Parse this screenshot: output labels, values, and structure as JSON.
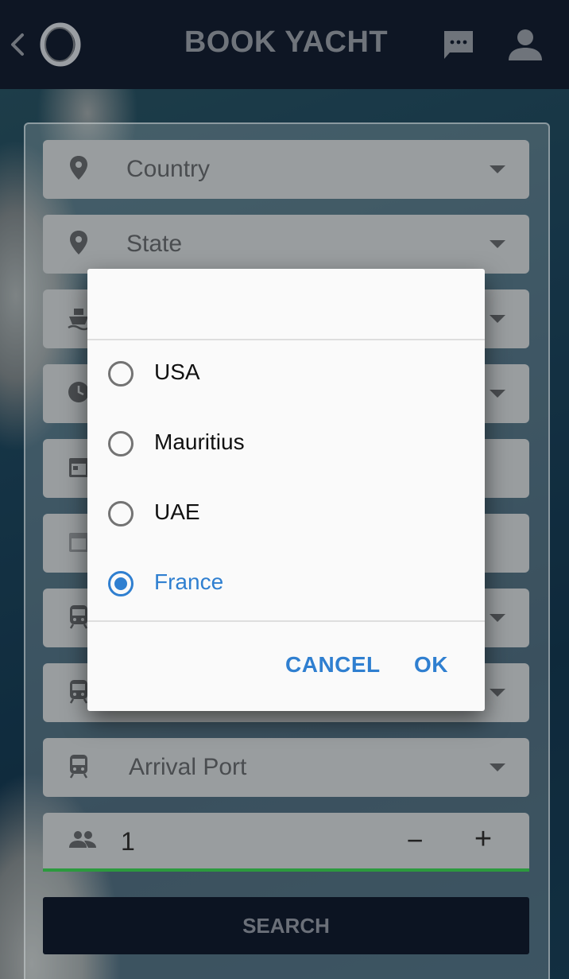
{
  "app_bar": {
    "title": "BOOK YACHT",
    "icons": {
      "back": "back-icon",
      "logo": "logo-icon",
      "chat": "chat-icon",
      "profile": "user-icon"
    }
  },
  "form": {
    "fields": [
      {
        "label": "Country",
        "icon": "location-pin-icon"
      },
      {
        "label": "State",
        "icon": "location-pin-icon"
      },
      {
        "label": "",
        "icon": "ship-icon"
      },
      {
        "label": "",
        "icon": "clock-icon"
      },
      {
        "label": "",
        "icon": "calendar-icon"
      },
      {
        "label": "",
        "icon": "calendar-icon"
      },
      {
        "label": "",
        "icon": "train-icon"
      },
      {
        "label": "",
        "icon": "train-icon"
      },
      {
        "label": "Arrival Port",
        "icon": "train-icon"
      }
    ],
    "guests": {
      "value": "1",
      "minus": "−",
      "plus": "+"
    },
    "search_label": "SEARCH"
  },
  "dialog": {
    "options": [
      {
        "label": "USA",
        "selected": false
      },
      {
        "label": "Mauritius",
        "selected": false
      },
      {
        "label": "UAE",
        "selected": false
      },
      {
        "label": "France",
        "selected": true
      }
    ],
    "cancel_label": "CANCEL",
    "ok_label": "OK"
  },
  "colors": {
    "accent": "#2f7fd0",
    "app_bar": "#0e1624",
    "field_underline": "#2c9a3e"
  }
}
